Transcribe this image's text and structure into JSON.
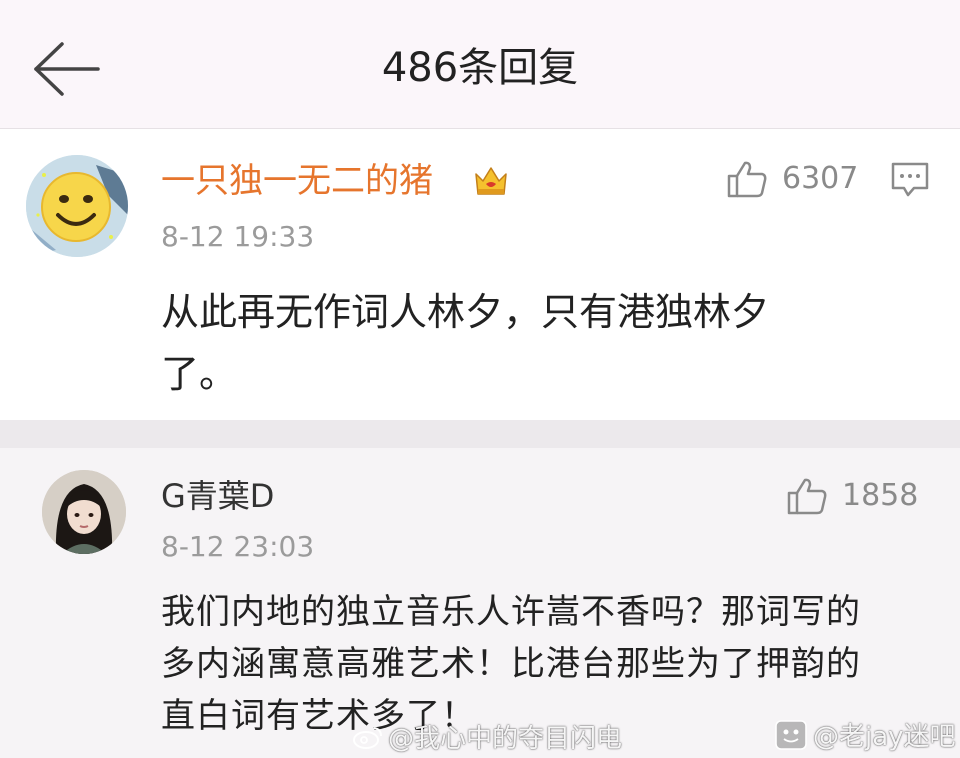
{
  "header": {
    "title": "486条回复",
    "back_icon": "arrow-left-icon"
  },
  "main_comment": {
    "username": "一只独一无二的猪",
    "username_color": "#e6752d",
    "badge_icon": "crown-icon",
    "timestamp": "8-12 19:33",
    "like_count": "6307",
    "text_line1": "从此再无作词人林夕，只有港独林夕",
    "text_line2": "了。"
  },
  "reply": {
    "username": "G青葉D",
    "timestamp": "8-12 23:03",
    "like_count": "1858",
    "text_line1": "我们内地的独立音乐人许嵩不香吗？那词写的",
    "text_line2": "多内涵寓意高雅艺术！比港台那些为了押韵的",
    "text_line3": "直白词有艺术多了！"
  },
  "watermarks": {
    "left": "@我心中的夺目闪电",
    "right": "@老jay迷吧"
  }
}
